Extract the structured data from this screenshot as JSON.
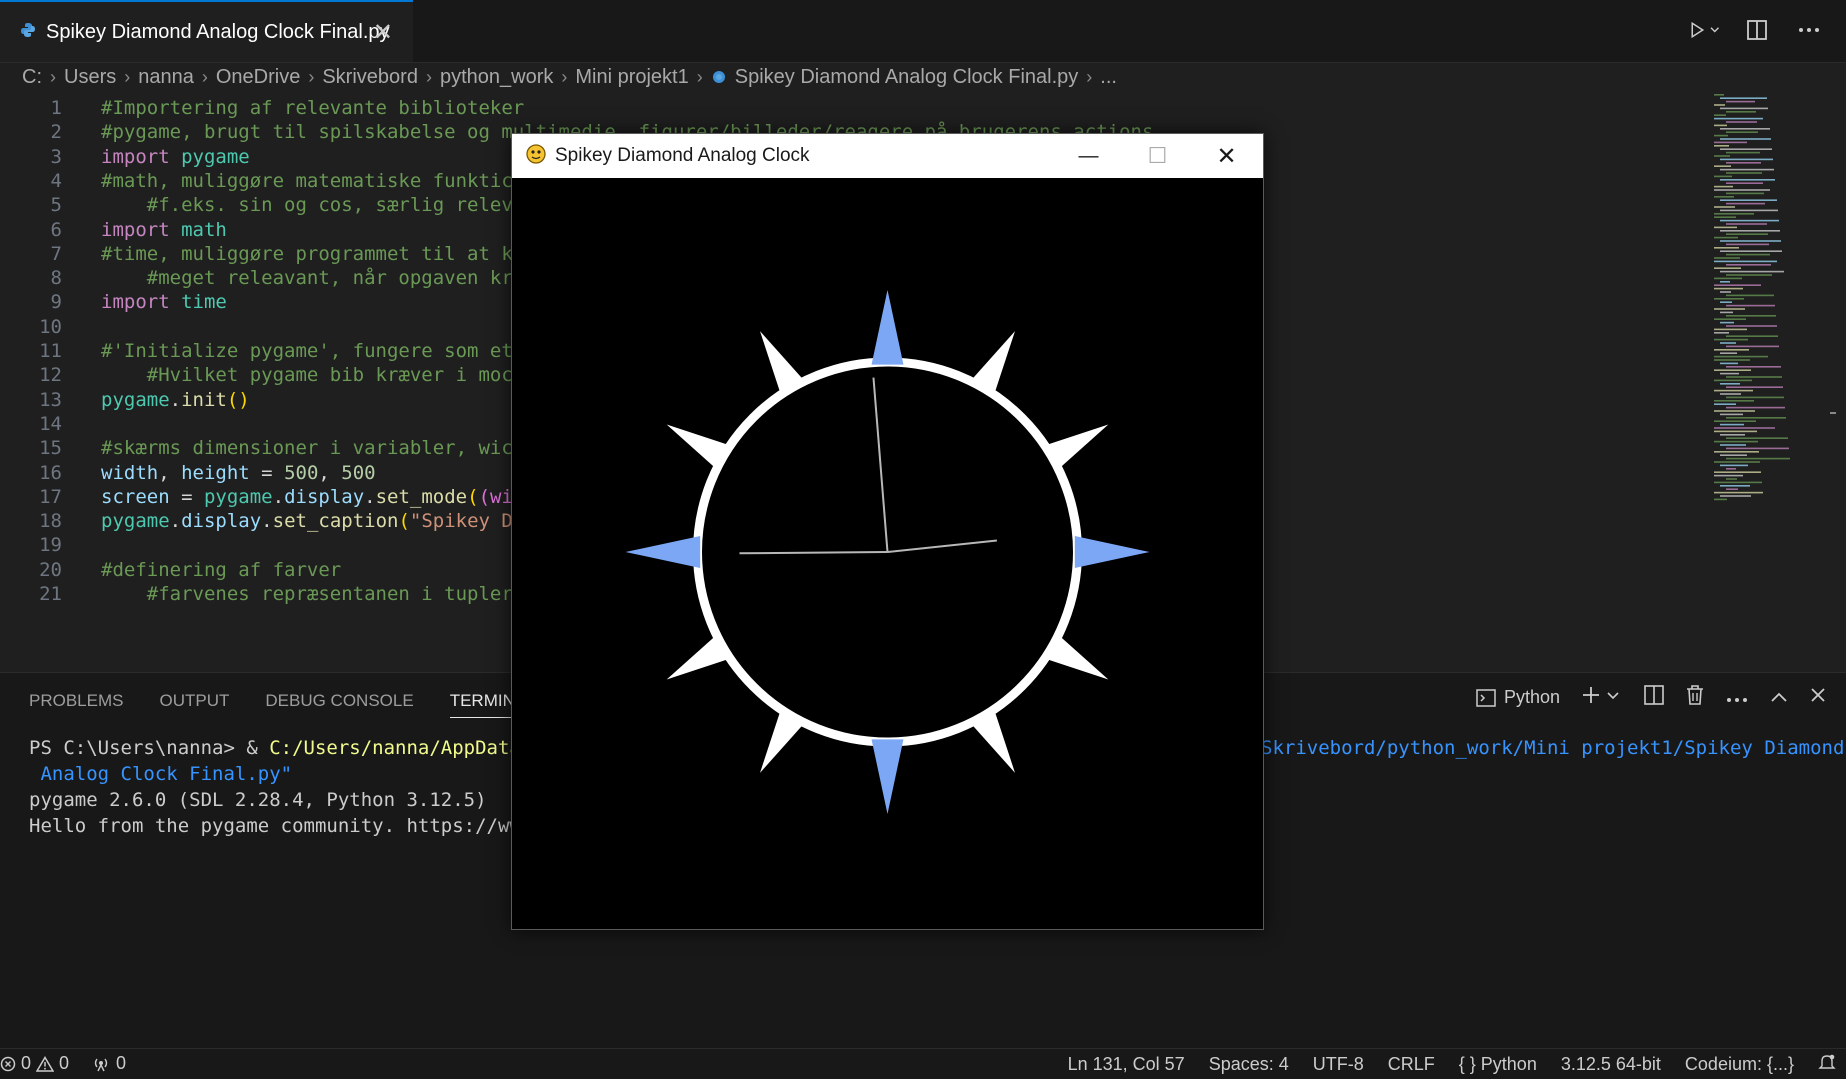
{
  "editor_tab": {
    "title": "Spikey Diamond Analog Clock Final.py",
    "close": "✕"
  },
  "breadcrumb": [
    "C:",
    "Users",
    "nanna",
    "OneDrive",
    "Skrivebord",
    "python_work",
    "Mini projekt1",
    "Spikey Diamond Analog Clock Final.py",
    "..."
  ],
  "code_lines": [
    {
      "n": "1",
      "tokens": [
        [
          "c-com",
          "#Importering af relevante biblioteker"
        ]
      ]
    },
    {
      "n": "2",
      "tokens": [
        [
          "c-com",
          "#pygame, brugt til spilskabelse og multimedie, figurer/billeder/reagere på brugerens actions"
        ]
      ]
    },
    {
      "n": "3",
      "tokens": [
        [
          "c-kw",
          "import "
        ],
        [
          "c-mod",
          "pygame"
        ]
      ]
    },
    {
      "n": "4",
      "tokens": [
        [
          "c-com",
          "#math, muliggøre matematiske funktic"
        ]
      ]
    },
    {
      "n": "5",
      "tokens": [
        [
          "c-com",
          "    #f.eks. sin og cos, særlig relev"
        ]
      ]
    },
    {
      "n": "6",
      "tokens": [
        [
          "c-kw",
          "import "
        ],
        [
          "c-mod",
          "math"
        ]
      ]
    },
    {
      "n": "7",
      "tokens": [
        [
          "c-com",
          "#time, muliggøre programmet til at k"
        ]
      ]
    },
    {
      "n": "8",
      "tokens": [
        [
          "c-com",
          "    #meget releavant, når opgaven kr"
        ]
      ]
    },
    {
      "n": "9",
      "tokens": [
        [
          "c-kw",
          "import "
        ],
        [
          "c-mod",
          "time"
        ]
      ]
    },
    {
      "n": "10",
      "tokens": []
    },
    {
      "n": "11",
      "tokens": [
        [
          "c-com",
          "#'Initialize pygame', fungere som et"
        ]
      ]
    },
    {
      "n": "12",
      "tokens": [
        [
          "c-com",
          "    #Hvilket pygame bib kræver i moc"
        ]
      ]
    },
    {
      "n": "13",
      "tokens": [
        [
          "c-mod",
          "pygame"
        ],
        [
          "c-pl",
          "."
        ],
        [
          "c-fn",
          "init"
        ],
        [
          "c-p1",
          "()"
        ]
      ]
    },
    {
      "n": "14",
      "tokens": []
    },
    {
      "n": "15",
      "tokens": [
        [
          "c-com",
          "#skærms dimensioner i variabler, wic"
        ]
      ]
    },
    {
      "n": "16",
      "tokens": [
        [
          "c-var",
          "width"
        ],
        [
          "c-pl",
          ", "
        ],
        [
          "c-var",
          "height"
        ],
        [
          "c-pl",
          " = "
        ],
        [
          "c-num",
          "500"
        ],
        [
          "c-pl",
          ", "
        ],
        [
          "c-num",
          "500"
        ]
      ]
    },
    {
      "n": "17",
      "tokens": [
        [
          "c-var",
          "screen"
        ],
        [
          "c-pl",
          " = "
        ],
        [
          "c-mod",
          "pygame"
        ],
        [
          "c-pl",
          "."
        ],
        [
          "c-var",
          "display"
        ],
        [
          "c-pl",
          "."
        ],
        [
          "c-fn",
          "set_mode"
        ],
        [
          "c-p1",
          "("
        ],
        [
          "c-p2",
          "(wi"
        ]
      ]
    },
    {
      "n": "18",
      "tokens": [
        [
          "c-mod",
          "pygame"
        ],
        [
          "c-pl",
          "."
        ],
        [
          "c-var",
          "display"
        ],
        [
          "c-pl",
          "."
        ],
        [
          "c-fn",
          "set_caption"
        ],
        [
          "c-p1",
          "("
        ],
        [
          "c-str",
          "\"Spikey D"
        ]
      ]
    },
    {
      "n": "19",
      "tokens": []
    },
    {
      "n": "20",
      "tokens": [
        [
          "c-com",
          "#definering af farver"
        ]
      ]
    },
    {
      "n": "21",
      "tokens": [
        [
          "c-com",
          "    #farvenes repræsentanen i tupler"
        ]
      ]
    }
  ],
  "panel": {
    "tabs": [
      "PROBLEMS",
      "OUTPUT",
      "DEBUG CONSOLE",
      "TERMINAL"
    ],
    "active_tab": "TERMINAL",
    "shell_label": "Python"
  },
  "terminal": {
    "prompt": "PS C:\\Users\\nanna> & ",
    "cmd_path": "C:/Users/nanna/AppData/",
    "cmd_path_tail": "Skrivebord/python_work/Mini projekt1/Spikey Diamond",
    "cmd_line2": " Analog Clock Final.py\"",
    "line3": "pygame 2.6.0 (SDL 2.28.4, Python 3.12.5)",
    "line4": "Hello from the pygame community. https://www"
  },
  "status": {
    "errors": "0",
    "warnings": "0",
    "ports": "0",
    "position": "Ln 131, Col 57",
    "spaces": "Spaces: 4",
    "encoding": "UTF-8",
    "eol": "CRLF",
    "language": "{ } Python",
    "interpreter": "3.12.5 64-bit",
    "codeium": "Codeium: {...}"
  },
  "pygame_window": {
    "title": "Spikey Diamond Analog Clock",
    "minimize": "—",
    "maximize": "☐",
    "close": "✕"
  },
  "clock": {
    "colors": {
      "ring": "#ffffff",
      "accent_spike": "#7ba7f5",
      "plain_spike": "#ffffff",
      "hands": "#b8b8b8",
      "background": "#000000"
    },
    "accent_spikes_at_hours": [
      12,
      3,
      6,
      9
    ],
    "time_shown": {
      "hour": 8,
      "minute": 59,
      "second": 14
    }
  }
}
